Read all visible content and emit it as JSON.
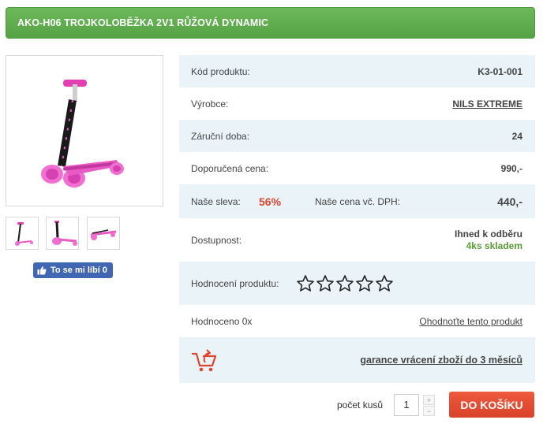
{
  "product": {
    "title": "AKO-H06 TROJKOLOBĚŽKA 2V1 RŮŽOVÁ DYNAMIC"
  },
  "social": {
    "like_label": "To se mi líbí 0"
  },
  "details": {
    "code_label": "Kód produktu:",
    "code_value": "K3-01-001",
    "maker_label": "Výrobce:",
    "maker_value": "NILS EXTREME",
    "warranty_label": "Záruční doba:",
    "warranty_value": "24",
    "rrp_label": "Doporučená cena:",
    "rrp_value": "990,-",
    "discount_label": "Naše sleva:",
    "discount_value": "56%",
    "our_price_label": "Naše cena vč. DPH:",
    "our_price_value": "440,-",
    "availability_label": "Dostupnost:",
    "availability_value": "Ihned k odběru",
    "stock_value": "4ks skladem",
    "rating_label": "Hodnocení produktu:",
    "rated_label": "Hodnoceno 0x",
    "rate_link": "Ohodnoťte tento produkt",
    "guarantee_link": "garance vrácení zboží do 3 měsíců"
  },
  "rating": {
    "value": 0,
    "max": 5
  },
  "cart": {
    "qty_label": "počet kusů",
    "qty_value": "1",
    "plus": "+",
    "minus": "−",
    "button": "DO KOŠÍKU"
  },
  "colors": {
    "accent_green": "#5aa548",
    "price_red": "#e0452e",
    "link_blue": "#2a5ea8",
    "stock_green": "#5a9d35",
    "row_shade": "#eaf4f8",
    "facebook_blue": "#4267b2"
  },
  "icons": {
    "like": "thumbs-up-icon",
    "star": "star-outline-icon",
    "return": "cart-return-icon"
  }
}
